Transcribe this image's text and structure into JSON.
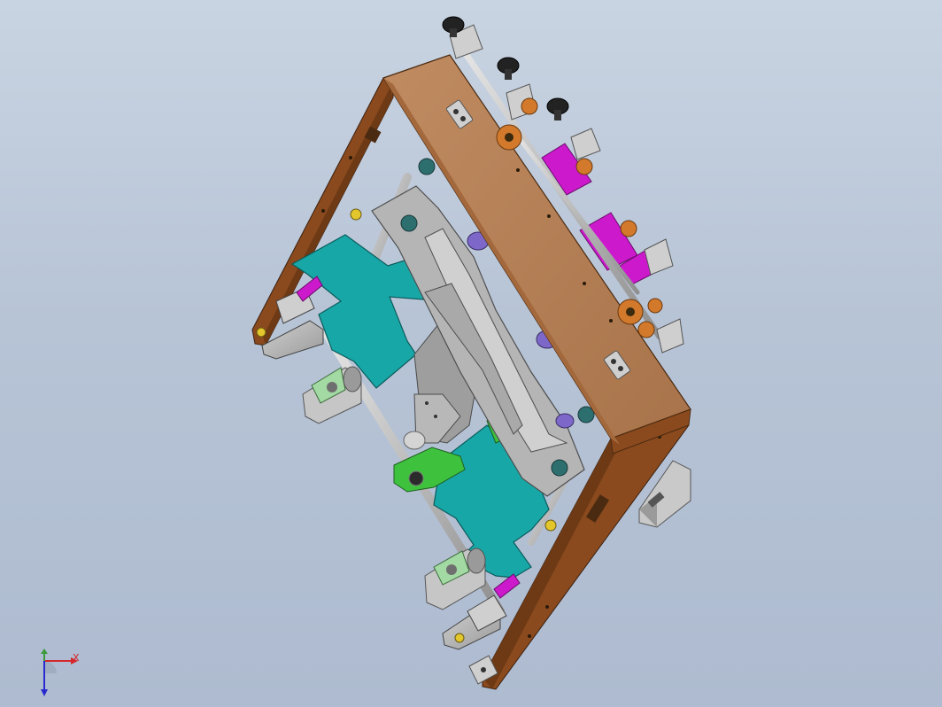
{
  "viewport": {
    "background_top": "#c9d4e2",
    "background_bottom": "#aebbd0"
  },
  "model": {
    "colors": {
      "frame_plate": "#b07a52",
      "frame_side": "#8a4a1e",
      "steel": "#b5b5b5",
      "teal_plate": "#18a7a7",
      "magenta_guide": "#cc19cc",
      "green_block": "#3ec23e",
      "purple_part": "#7d67c9",
      "dark_knob": "#222222",
      "gear_orange": "#d3792b"
    }
  },
  "triad": {
    "x_label": "X",
    "x_color": "#d4262b",
    "y_color": "#3a9a3c",
    "z_color": "#2a2ad0"
  }
}
